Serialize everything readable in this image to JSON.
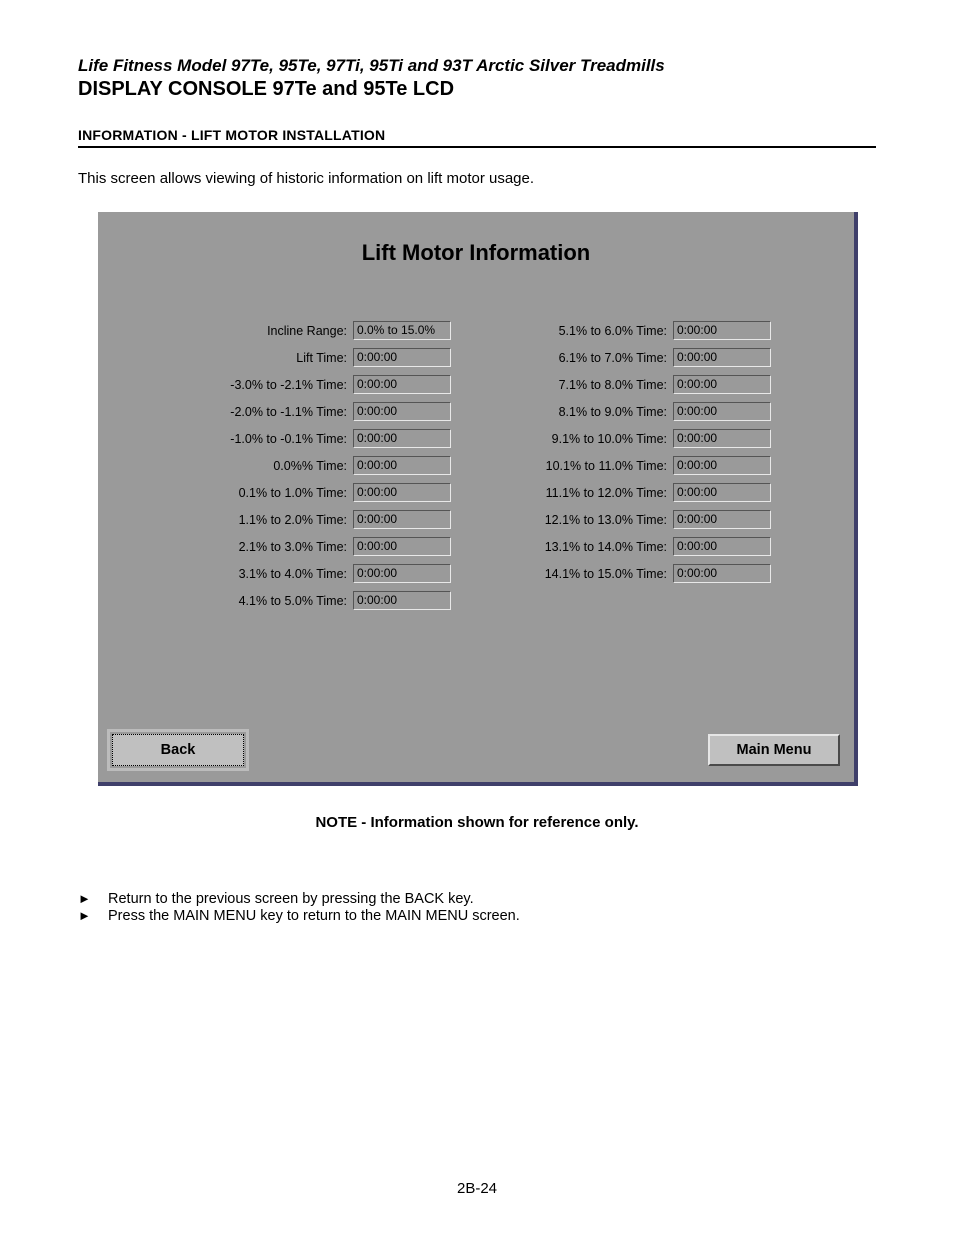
{
  "header": {
    "line1": "Life Fitness Model 97Te, 95Te, 97Ti, 95Ti and 93T Arctic Silver Treadmills",
    "line2": "DISPLAY CONSOLE 97Te and 95Te LCD"
  },
  "section_heading": "INFORMATION - LIFT MOTOR INSTALLATION",
  "intro_text": "This screen allows viewing of historic information on lift motor usage.",
  "panel": {
    "title": "Lift Motor Information",
    "left_rows": [
      {
        "label": "Incline Range:",
        "value": "0.0% to 15.0%"
      },
      {
        "label": "Lift Time:",
        "value": "0:00:00"
      },
      {
        "label": "-3.0% to -2.1% Time:",
        "value": "0:00:00"
      },
      {
        "label": "-2.0% to -1.1% Time:",
        "value": "0:00:00"
      },
      {
        "label": "-1.0% to -0.1% Time:",
        "value": "0:00:00"
      },
      {
        "label": "0.0%% Time:",
        "value": "0:00:00"
      },
      {
        "label": "0.1% to 1.0% Time:",
        "value": "0:00:00"
      },
      {
        "label": "1.1% to 2.0% Time:",
        "value": "0:00:00"
      },
      {
        "label": "2.1% to 3.0% Time:",
        "value": "0:00:00"
      },
      {
        "label": "3.1% to 4.0% Time:",
        "value": "0:00:00"
      },
      {
        "label": "4.1% to 5.0% Time:",
        "value": "0:00:00"
      }
    ],
    "right_rows": [
      {
        "label": "5.1% to 6.0% Time:",
        "value": "0:00:00"
      },
      {
        "label": "6.1% to 7.0% Time:",
        "value": "0:00:00"
      },
      {
        "label": "7.1% to 8.0% Time:",
        "value": "0:00:00"
      },
      {
        "label": "8.1% to 9.0% Time:",
        "value": "0:00:00"
      },
      {
        "label": "9.1% to 10.0% Time:",
        "value": "0:00:00"
      },
      {
        "label": "10.1% to 11.0% Time:",
        "value": "0:00:00"
      },
      {
        "label": "11.1% to 12.0% Time:",
        "value": "0:00:00"
      },
      {
        "label": "12.1% to 13.0% Time:",
        "value": "0:00:00"
      },
      {
        "label": "13.1% to 14.0% Time:",
        "value": "0:00:00"
      },
      {
        "label": "14.1% to 15.0% Time:",
        "value": "0:00:00"
      }
    ],
    "buttons": {
      "back": "Back",
      "main_menu": "Main Menu"
    }
  },
  "note": "NOTE - Information shown for reference only.",
  "instructions": [
    "Return to the previous screen by pressing the BACK key.",
    "Press the MAIN MENU key to return to the MAIN MENU screen."
  ],
  "page_number": "2B-24"
}
